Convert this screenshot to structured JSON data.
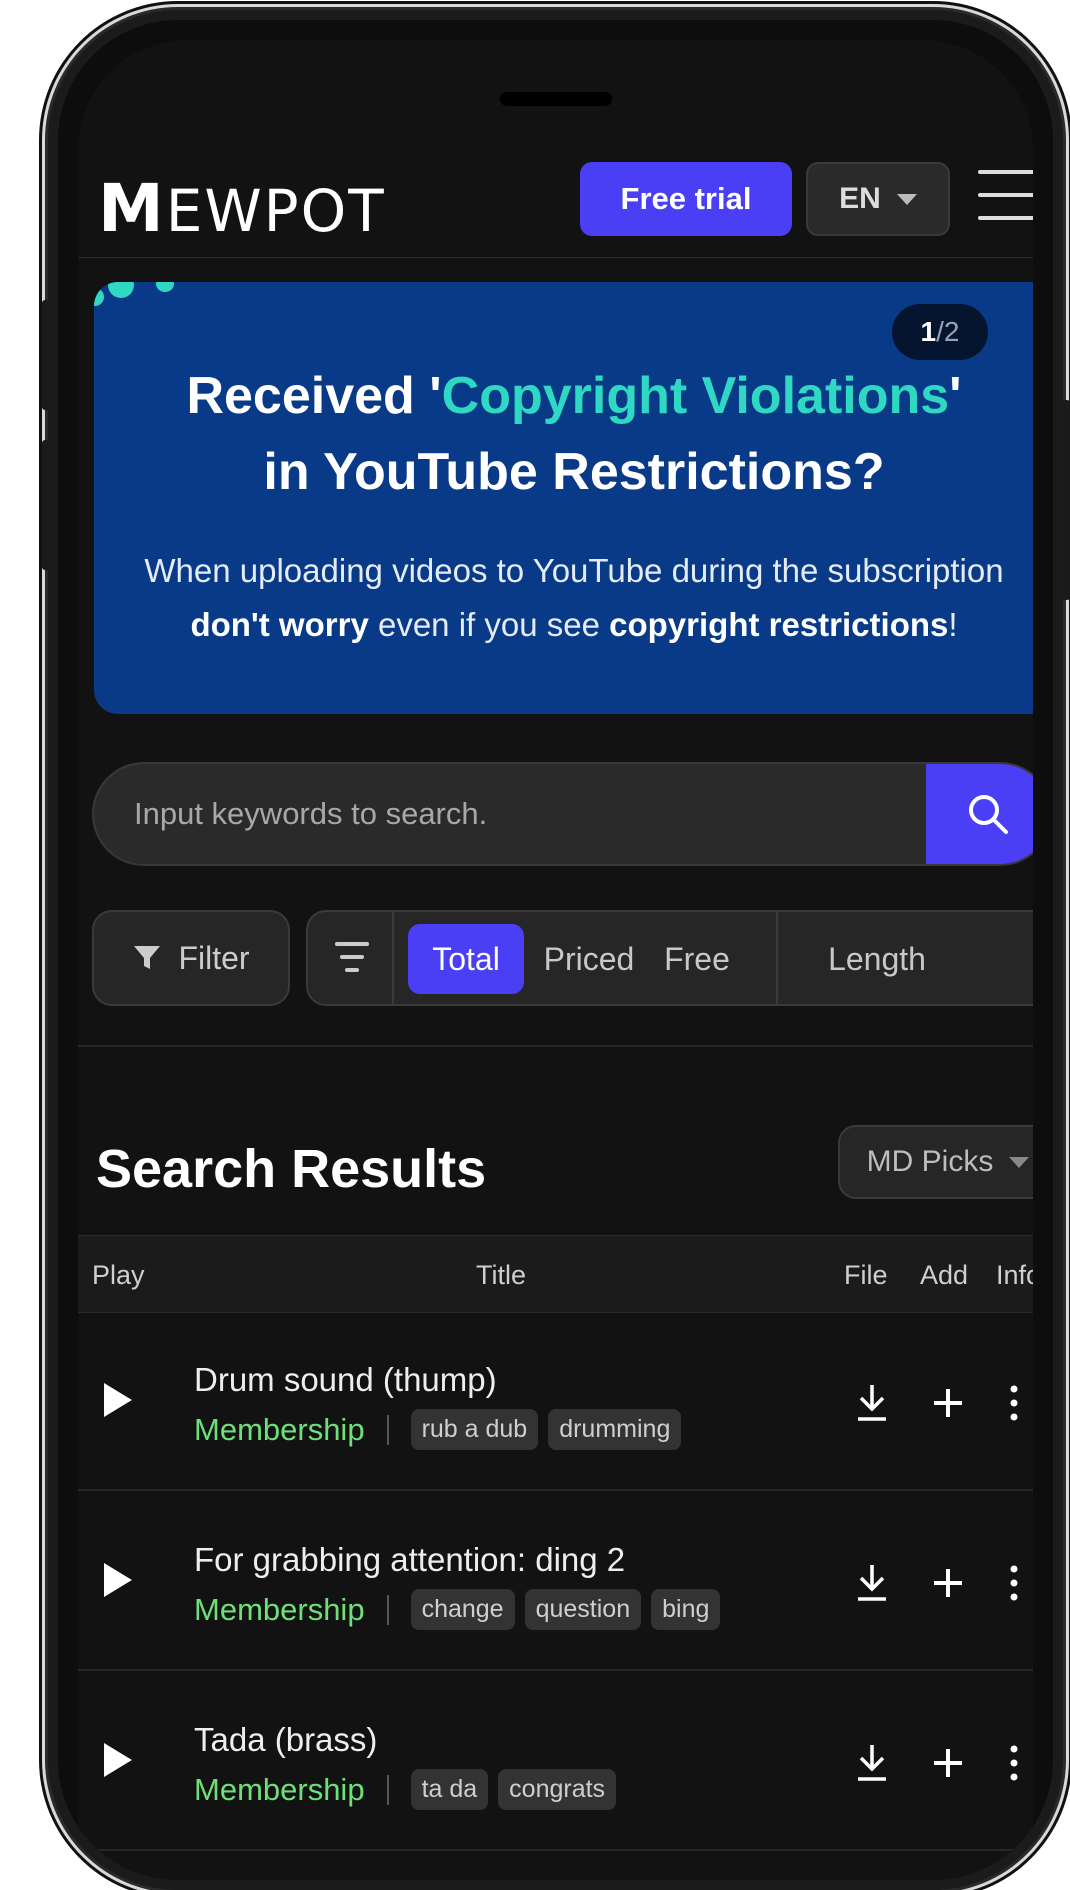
{
  "header": {
    "logo_lead": "M",
    "logo_rest": "EWPOT",
    "trial_label": "Free trial",
    "lang_label": "EN"
  },
  "banner": {
    "page_current": "1",
    "page_sep": "/",
    "page_total": "2",
    "title_pre": "Received '",
    "title_highlight": "Copyright Violations",
    "title_post": "'",
    "title_line2": "in YouTube Restrictions?",
    "sub_line1": "When uploading videos to YouTube during the subscription",
    "sub_bold1": "don't worry",
    "sub_mid": " even if you see ",
    "sub_bold2": "copyright restrictions",
    "sub_end": "!",
    "accent": "#2fd8c2",
    "background": "#093a88"
  },
  "search": {
    "placeholder": "Input keywords to search.",
    "value": ""
  },
  "filters": {
    "filter_label": "Filter",
    "segments": [
      "Total",
      "Priced",
      "Free",
      "Length"
    ],
    "active": "Total"
  },
  "results": {
    "title": "Search Results",
    "sort_label": "MD Picks",
    "columns": {
      "play": "Play",
      "title": "Title",
      "file": "File",
      "add": "Add",
      "info": "Info"
    },
    "rows": [
      {
        "title": "Drum sound (thump)",
        "license": "Membership",
        "tags": [
          "rub a dub",
          "drumming"
        ]
      },
      {
        "title": "For grabbing attention: ding 2",
        "license": "Membership",
        "tags": [
          "change",
          "question",
          "bing"
        ]
      },
      {
        "title": "Tada (brass)",
        "license": "Membership",
        "tags": [
          "ta da",
          "congrats"
        ]
      }
    ]
  },
  "colors": {
    "primary": "#4a3ff5",
    "membership": "#6ee07a",
    "background": "#121212"
  },
  "icons": {
    "search": "search-icon",
    "filter": "funnel-icon",
    "sort": "sort-icon",
    "play": "play-icon",
    "download": "download-icon",
    "add": "plus-icon",
    "more": "more-vertical-icon"
  }
}
